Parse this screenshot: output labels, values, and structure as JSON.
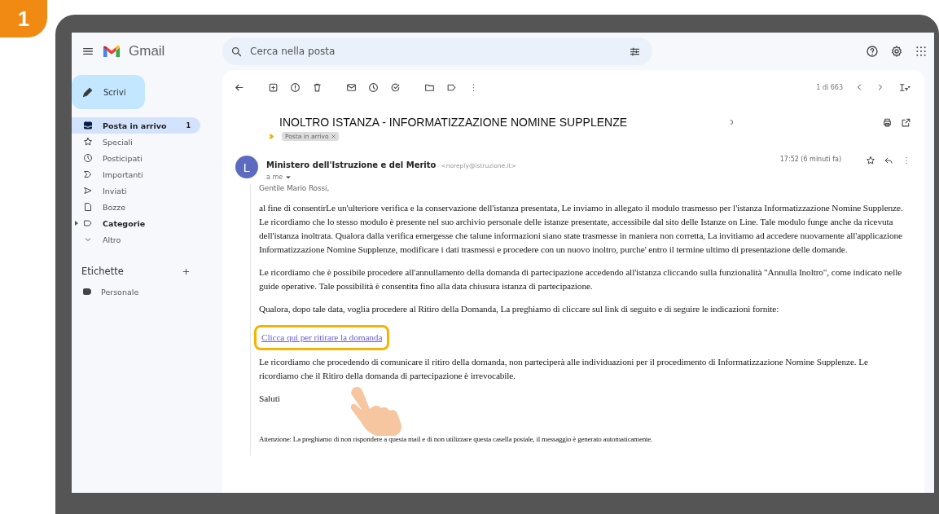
{
  "step_badge": "1",
  "app": {
    "name": "Gmail"
  },
  "compose_button": "Scrivi",
  "sidebar": {
    "items": [
      {
        "label": "Posta in arrivo",
        "kind": "inbox",
        "count": "1",
        "selected": true,
        "unread": true
      },
      {
        "label": "Speciali",
        "kind": "star",
        "selected": false,
        "unread": false
      },
      {
        "label": "Posticipati",
        "kind": "clock",
        "selected": false,
        "unread": false
      },
      {
        "label": "Importanti",
        "kind": "important",
        "selected": false,
        "unread": false
      },
      {
        "label": "Inviati",
        "kind": "sent",
        "selected": false,
        "unread": false
      },
      {
        "label": "Bozze",
        "kind": "draft",
        "selected": false,
        "unread": false
      },
      {
        "label": "Categorie",
        "kind": "category",
        "selected": false,
        "unread": true
      },
      {
        "label": "Altro",
        "kind": "more",
        "selected": false,
        "unread": false
      }
    ],
    "labels_heading": "Etichette",
    "labels": [
      {
        "label": "Personale"
      }
    ]
  },
  "search": {
    "placeholder": "Cerca nella posta"
  },
  "toolbar": {
    "pagination": "1 di 663"
  },
  "message": {
    "subject": "INOLTRO ISTANZA - INFORMATIZZAZIONE NOMINE SUPPLENZE",
    "labels": [
      "Posta in arrivo"
    ],
    "sender_initial": "L",
    "sender_name": "Ministero dell'Istruzione e del Merito",
    "sender_email": "<noreply@istruzione.it>",
    "recipient": "a me",
    "time": "17:52 (6 minuti fa)",
    "greeting": "Gentile Mario Rossi,",
    "paragraphs": [
      "al fine di consentirLe un'ulteriore verifica e la conservazione dell'istanza presentata, Le inviamo in allegato il modulo trasmesso per l'istanza Informatizzazione Nomine Supplenze. Le ricordiamo che lo stesso modulo è presente nel suo archivio personale delle istanze presentate, accessibile dal sito delle Istanze on Line. Tale modulo funge anche da ricevuta dell'istanza inoltrata. Qualora dalla verifica emergesse che talune informazioni siano state trasmesse in maniera non corretta, La invitiamo ad accedere nuovamente all'applicazione Informatizzazione Nomine Supplenze, modificare i dati trasmessi e procedere con un nuovo inoltro, purche' entro il termine ultimo di presentazione delle domande.",
      "Le ricordiamo che è possibile procedere all'annullamento della domanda di partecipazione accedendo all'istanza cliccando sulla funzionalità \"Annulla Inoltro\", come indicato nelle guide operative. Tale possibilità è consentita fino alla data chiusura istanza di partecipazione.",
      "Qualora, dopo tale data, voglia procedere al Ritiro della Domanda, La preghiamo di cliccare sul link di seguito e di seguire le indicazioni fornite:"
    ],
    "link": {
      "text": "Clicca qui per ritirare la domanda",
      "highlighted": true
    },
    "after_link": "Le ricordiamo che procedendo di comunicare il ritiro della domanda, non parteciperà alle individuazioni per il procedimento di Informatizzazione Nomine Supplenze. Le ricordiamo che il Ritiro della domanda di partecipazione è irrevocabile.",
    "closing": "Saluti",
    "footer": "Attenzione: La preghiamo di non rispondere a questa mail e di non utilizzare questa casella postale, il messaggio è generato automaticamente."
  }
}
